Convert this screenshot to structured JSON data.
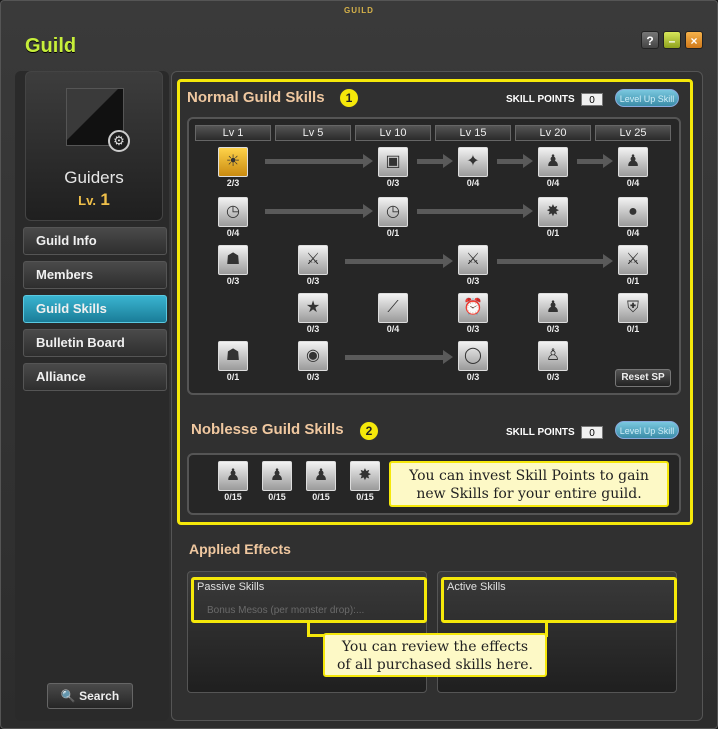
{
  "window": {
    "titlebar": "GUILD",
    "title": "Guild"
  },
  "guild": {
    "name": "Guiders",
    "level_tag": "Lv.",
    "level": "1"
  },
  "nav": [
    {
      "label": "Guild Info",
      "active": false
    },
    {
      "label": "Members",
      "active": false
    },
    {
      "label": "Guild Skills",
      "active": true
    },
    {
      "label": "Bulletin Board",
      "active": false
    },
    {
      "label": "Alliance",
      "active": false
    }
  ],
  "search_label": "Search",
  "normal": {
    "title": "Normal Guild Skills",
    "badge": "1",
    "sp_label": "SKILL POINTS",
    "sp_value": "0",
    "levelup": "Level Up Skill",
    "lv_headers": [
      "Lv 1",
      "Lv 5",
      "Lv 10",
      "Lv 15",
      "Lv 20",
      "Lv 25"
    ],
    "skills": [
      {
        "icon": "sun-icon",
        "count": "2/3",
        "gold": true
      },
      {
        "icon": "book-icon",
        "count": "0/3"
      },
      {
        "icon": "wand-icon",
        "count": "0/4"
      },
      {
        "icon": "party-icon",
        "count": "0/4"
      },
      {
        "icon": "team-icon",
        "count": "0/4"
      },
      {
        "icon": "clock-icon",
        "count": "0/4"
      },
      {
        "icon": "clock-icon",
        "count": "0/1"
      },
      {
        "icon": "burst-icon",
        "count": "0/1"
      },
      {
        "icon": "bomb-icon",
        "count": "0/4"
      },
      {
        "icon": "people-icon",
        "count": "0/3"
      },
      {
        "icon": "sword-icon",
        "count": "0/3"
      },
      {
        "icon": "sword-icon",
        "count": "0/3"
      },
      {
        "icon": "sword-icon",
        "count": "0/1"
      },
      {
        "icon": "star-icon",
        "count": "0/3"
      },
      {
        "icon": "slash-icon",
        "count": "0/4"
      },
      {
        "icon": "alarm-icon",
        "count": "0/3"
      },
      {
        "icon": "group-icon",
        "count": "0/3"
      },
      {
        "icon": "shield-icon",
        "count": "0/1"
      },
      {
        "icon": "people-icon",
        "count": "0/1"
      },
      {
        "icon": "orb-icon",
        "count": "0/3"
      },
      {
        "icon": "crystal-icon",
        "count": "0/3"
      },
      {
        "icon": "person-icon",
        "count": "0/3"
      }
    ],
    "reset": "Reset SP"
  },
  "noblesse": {
    "title": "Noblesse Guild Skills",
    "badge": "2",
    "sp_label": "SKILL POINTS",
    "sp_value": "0",
    "levelup": "Level Up Skill",
    "skills": [
      {
        "icon": "team-icon",
        "count": "0/15"
      },
      {
        "icon": "team-icon",
        "count": "0/15"
      },
      {
        "icon": "team-icon",
        "count": "0/15"
      },
      {
        "icon": "burst-icon",
        "count": "0/15"
      }
    ],
    "callout": [
      "You can invest Skill Points to gain",
      "new Skills for your entire guild."
    ]
  },
  "effects": {
    "title": "Applied Effects",
    "passive_header": "Passive Skills",
    "passive_item": "Bonus Mesos (per monster drop):...",
    "active_header": "Active Skills",
    "callout": [
      "You can review the effects",
      "of all purchased skills here."
    ]
  },
  "colors": {
    "highlight": "#f5e80a",
    "accent": "#c7ef3a",
    "active_tab": "#2a9ab8"
  }
}
